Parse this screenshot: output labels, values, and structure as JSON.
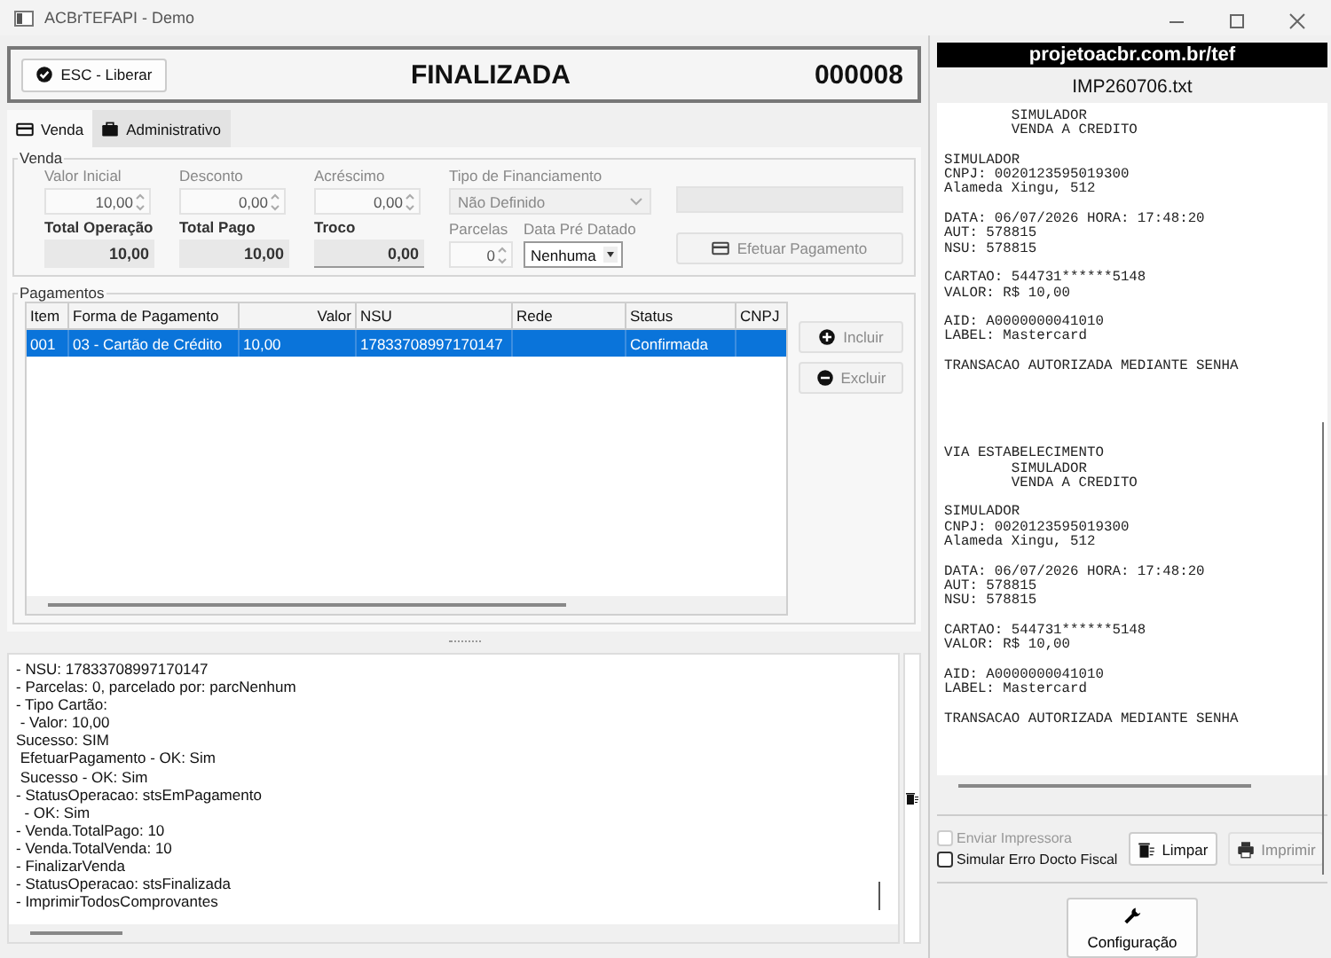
{
  "window": {
    "title": "ACBrTEFAPI - Demo"
  },
  "header": {
    "button": {
      "label": "ESC - Liberar"
    },
    "status": "FINALIZADA",
    "number": "000008"
  },
  "tabs": [
    {
      "label": "Venda",
      "selected": true
    },
    {
      "label": "Administrativo",
      "selected": false
    }
  ],
  "venda": {
    "title": "Venda",
    "fields": [
      {
        "label": "Valor Inicial",
        "value": "10,00",
        "kind": "spin"
      },
      {
        "label": "Desconto",
        "value": "0,00",
        "kind": "spin"
      },
      {
        "label": "Acréscimo",
        "value": "0,00",
        "kind": "spin"
      },
      {
        "label": "Tipo de Financiamento",
        "value": "Não Definido",
        "kind": "select"
      },
      {
        "kind": "blank"
      }
    ],
    "totals": [
      {
        "label": "Total Operação",
        "value": "10,00",
        "kind": "total"
      },
      {
        "label": "Total Pago",
        "value": "10,00",
        "kind": "total"
      },
      {
        "label": "Troco",
        "value": "0,00",
        "kind": "total"
      },
      {
        "label": "Parcelas",
        "value": "0",
        "kind": "spin"
      },
      {
        "label": "Data Pré Datado",
        "value": "Nenhuma",
        "kind": "combo"
      }
    ],
    "pay_button": {
      "label": "Efetuar Pagamento",
      "disabled": true
    }
  },
  "pagamentos": {
    "title": "Pagamentos",
    "columns": [
      "Item",
      "Forma de Pagamento",
      "Valor",
      "NSU",
      "Rede",
      "Status",
      "CNPJ"
    ],
    "rows": [
      {
        "selected": true,
        "cells": [
          "001",
          "03 - Cartão de Crédito",
          "10,00",
          "17833708997170147",
          null,
          "Confirmada",
          null
        ]
      }
    ],
    "buttons": [
      {
        "label": "Incluir",
        "disabled": true
      },
      {
        "label": "Excluir",
        "disabled": true
      }
    ]
  },
  "log": [
    "- NSU: 17833708997170147",
    "- Parcelas: 0, parcelado por: parcNenhum",
    "- Tipo Cartão:",
    " - Valor: 10,00",
    "Sucesso: SIM",
    " EfetuarPagamento - OK: Sim",
    " Sucesso - OK: Sim",
    "- StatusOperacao: stsEmPagamento",
    "  - OK: Sim",
    "- Venda.TotalPago: 10",
    "- Venda.TotalVenda: 10",
    "- FinalizarVenda",
    "- StatusOperacao: stsFinalizada",
    "- ImprimirTodosComprovantes"
  ],
  "banner": "projetoacbr.com.br/tef",
  "file_name": "IMP260706.txt",
  "receipt": [
    {
      "blocks": [
        [
          "        SIMULADOR",
          "        VENDA A CREDITO"
        ],
        [
          "SIMULADOR",
          "CNPJ: 0020123595019300",
          "Alameda Xingu, 512"
        ],
        [
          "DATA: 06/07/2026 HORA: 17:48:20",
          "AUT: 578815",
          "NSU: 578815"
        ],
        [
          "CARTAO: 544731******5148",
          "VALOR: R$ 10,00"
        ],
        [
          "AID: A0000000041010",
          "LABEL: Mastercard"
        ],
        [
          "TRANSACAO AUTORIZADA MEDIANTE SENHA"
        ]
      ]
    },
    {
      "blocks": [
        [
          "VIA ESTABELECIMENTO",
          "        SIMULADOR",
          "        VENDA A CREDITO"
        ],
        [
          "SIMULADOR",
          "CNPJ: 0020123595019300",
          "Alameda Xingu, 512"
        ],
        [
          "DATA: 06/07/2026 HORA: 17:48:20",
          "AUT: 578815",
          "NSU: 578815"
        ],
        [
          "CARTAO: 544731******5148",
          "VALOR: R$ 10,00"
        ],
        [
          "AID: A0000000041010",
          "LABEL: Mastercard"
        ],
        [
          "TRANSACAO AUTORIZADA MEDIANTE SENHA"
        ]
      ]
    }
  ],
  "options": [
    {
      "label": "Enviar Impressora",
      "checked": false,
      "disabled": true
    },
    {
      "label": "Simular Erro Docto Fiscal",
      "checked": false,
      "disabled": false
    }
  ],
  "print_buttons": [
    {
      "label": "Limpar",
      "disabled": false
    },
    {
      "label": "Imprimir",
      "disabled": true
    }
  ],
  "config_button": {
    "label": "Configuração"
  }
}
